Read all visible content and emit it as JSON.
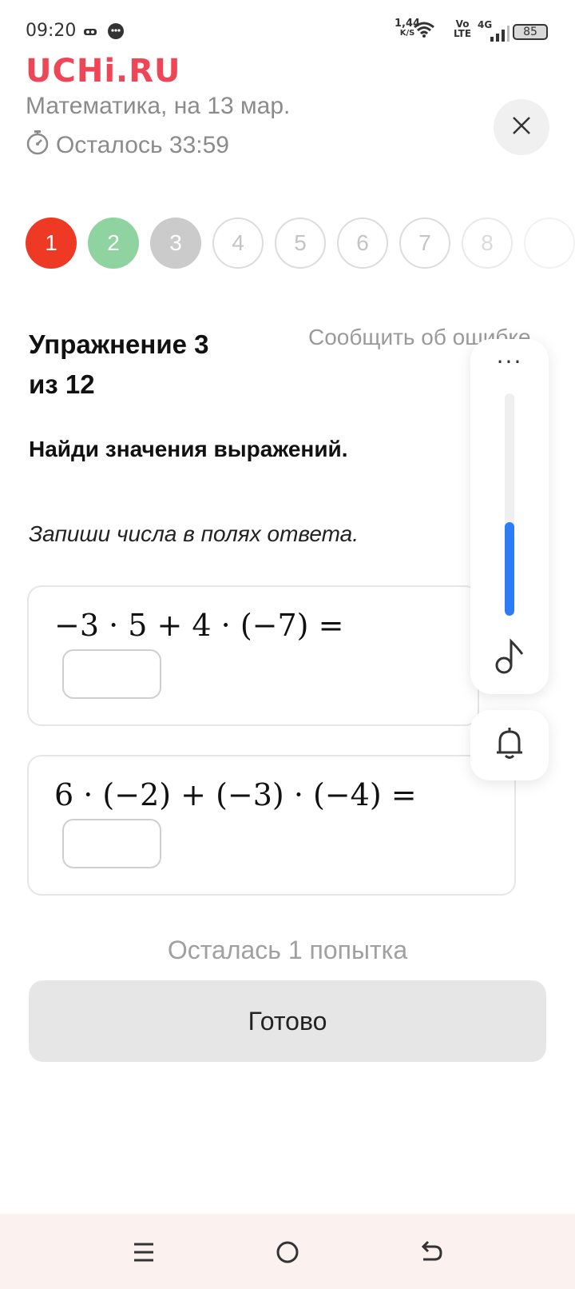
{
  "status_bar": {
    "time": "09:20",
    "net_speed_value": "1,44",
    "net_speed_unit": "K/S",
    "volte_top": "Vo",
    "volte_bottom": "LTE",
    "network": "4G",
    "battery": "85"
  },
  "header": {
    "logo": "UCHi.RU",
    "subject": "Математика, на 13 мар.",
    "timer": "Осталось 33:59"
  },
  "steps": [
    {
      "label": "1",
      "state": "wrong",
      "color": "#ee3a24"
    },
    {
      "label": "2",
      "state": "correct",
      "color": "#8fd3a0"
    },
    {
      "label": "3",
      "state": "current",
      "color": "#cbcbcb"
    },
    {
      "label": "4",
      "state": "pending"
    },
    {
      "label": "5",
      "state": "pending"
    },
    {
      "label": "6",
      "state": "pending"
    },
    {
      "label": "7",
      "state": "pending"
    },
    {
      "label": "8",
      "state": "pending"
    },
    {
      "label": "",
      "state": "pending"
    }
  ],
  "exercise": {
    "title_line1": "Упражнение 3",
    "title_line2": "из 12",
    "report_link": "Сообщить об ошибке",
    "instruction": "Найди значения выражений.",
    "hint": "Запиши числа в полях ответа."
  },
  "tasks": [
    {
      "expression": "−3 · 5 + 4 · (−7) =",
      "answer": ""
    },
    {
      "expression": "6 · (−2) + (−3) · (−4) =",
      "answer": ""
    }
  ],
  "attempts": "Осталась 1 попытка",
  "done_button": "Готово",
  "volume_panel": {
    "more_label": "···",
    "volume_level": 0.42,
    "accent": "#2b7cf6"
  },
  "colors": {
    "brand": "#ef4657"
  }
}
